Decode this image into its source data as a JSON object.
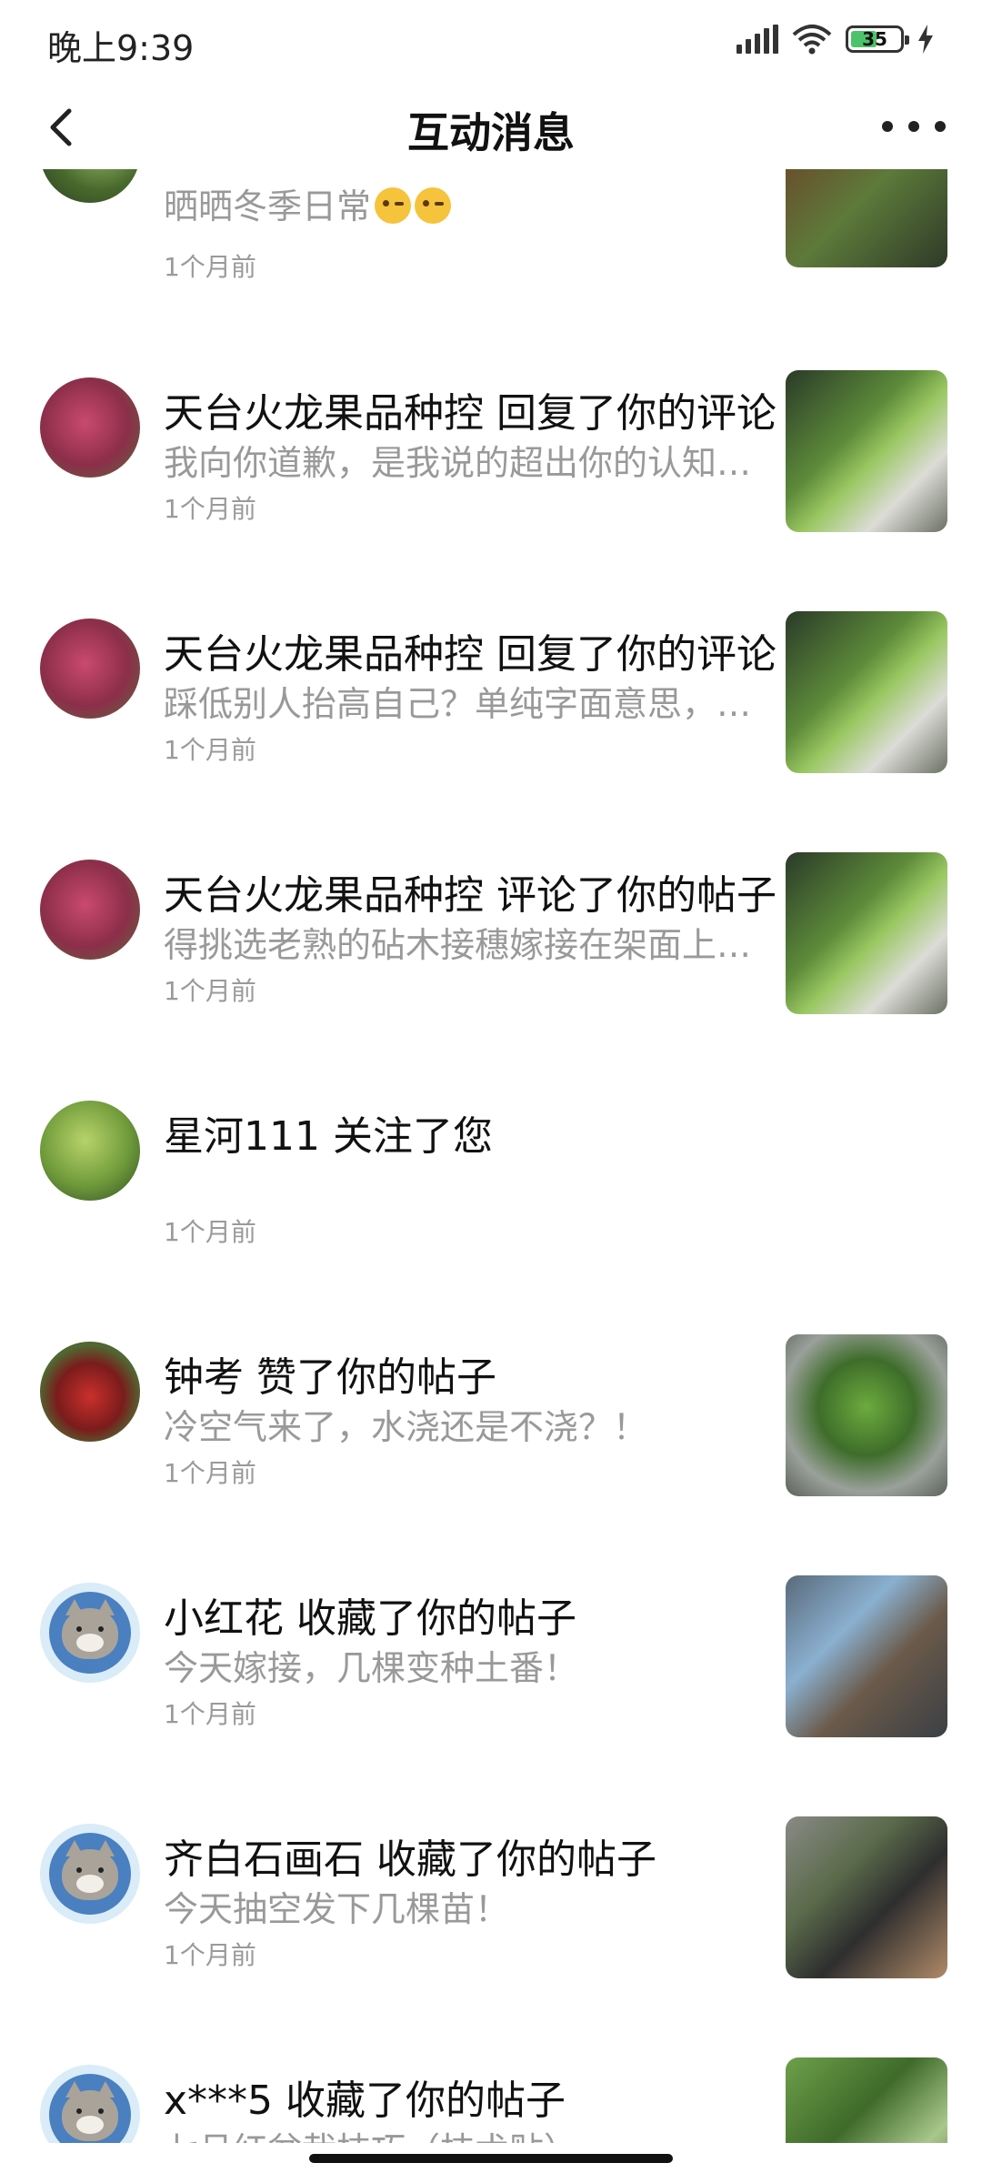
{
  "status_bar": {
    "time": "晚上9:39",
    "battery": "35"
  },
  "nav": {
    "title": "互动消息"
  },
  "items": [
    {
      "actor": "",
      "action": "",
      "snippet": "晒晒冬季日常",
      "emoji_count": 2,
      "time": "1个月前",
      "avatar": "plant",
      "thumb": "partial"
    },
    {
      "actor": "天台火龙果品种控",
      "action": "回复了你的评论",
      "snippet": "我向你道歉，是我说的超出你的认知…",
      "time": "1个月前",
      "avatar": "fruit",
      "thumb": "green"
    },
    {
      "actor": "天台火龙果品种控",
      "action": "回复了你的评论",
      "snippet": "踩低别人抬高自己？单纯字面意思，…",
      "time": "1个月前",
      "avatar": "fruit",
      "thumb": "green"
    },
    {
      "actor": "天台火龙果品种控",
      "action": "评论了你的帖子",
      "snippet": "得挑选老熟的砧木接穗嫁接在架面上…",
      "time": "1个月前",
      "avatar": "fruit",
      "thumb": "green"
    },
    {
      "actor": "星河111",
      "action": "关注了您",
      "snippet": "",
      "time": "1个月前",
      "avatar": "sprout",
      "thumb": ""
    },
    {
      "actor": "钟考",
      "action": "赞了你的帖子",
      "snippet": "冷空气来了，水浇还是不浇？！",
      "time": "1个月前",
      "avatar": "apple",
      "thumb": "berries"
    },
    {
      "actor": "小红花",
      "action": "收藏了你的帖子",
      "snippet": "今天嫁接，几棵变种土番！",
      "time": "1个月前",
      "avatar": "cat",
      "thumb": "graft"
    },
    {
      "actor": "齐白石画石",
      "action": "收藏了你的帖子",
      "snippet": "今天抽空发下几棵苗！",
      "time": "1个月前",
      "avatar": "cat",
      "thumb": "pot"
    },
    {
      "actor": "x***5",
      "action": "收藏了你的帖子",
      "snippet": "七月红盆栽技巧（技术贴）",
      "time": "",
      "avatar": "cat",
      "thumb": "bonsai"
    }
  ]
}
